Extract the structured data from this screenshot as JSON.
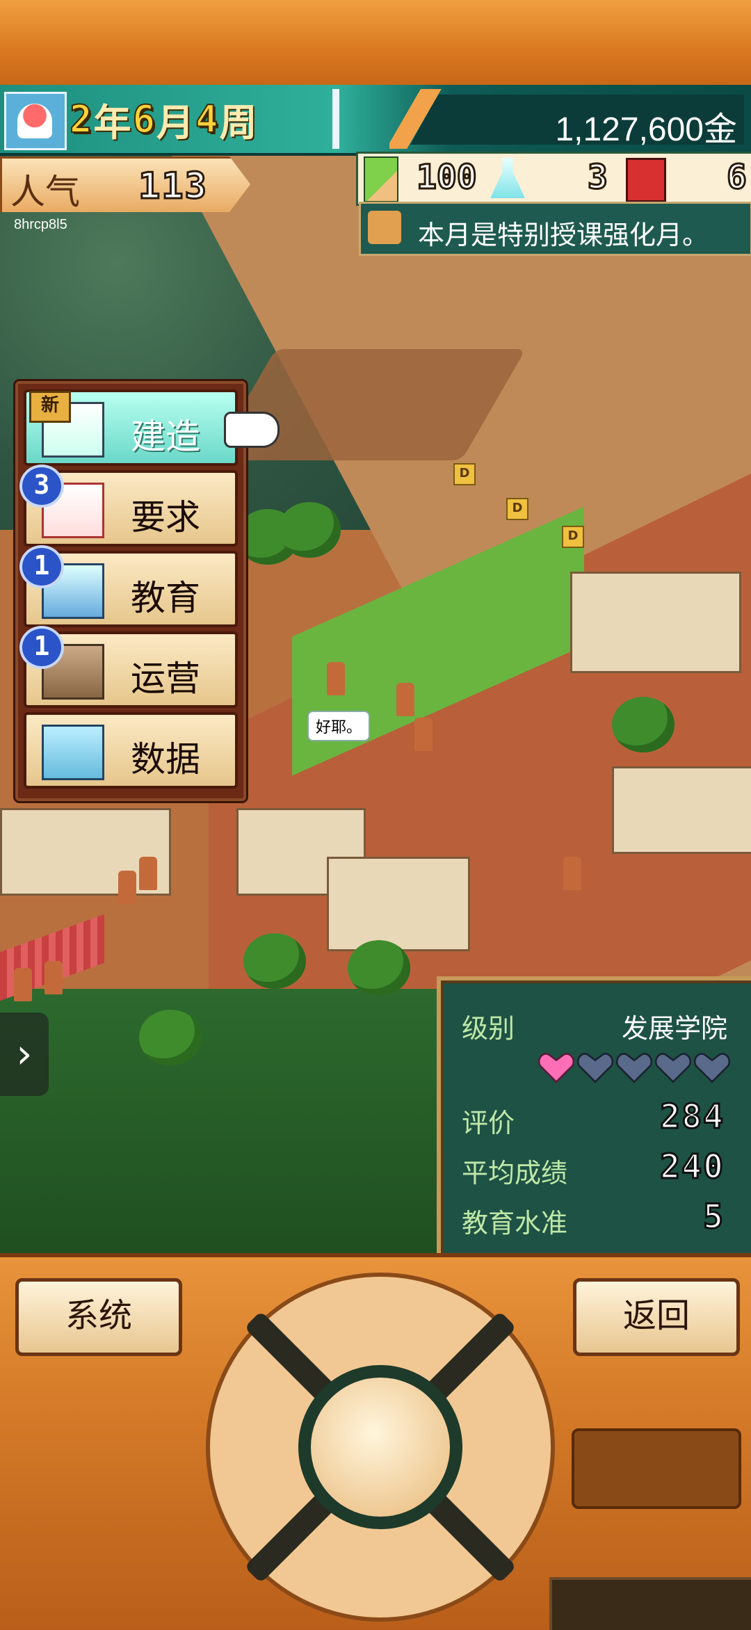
{
  "date": {
    "year": "2",
    "year_unit": "年",
    "month": "6",
    "month_unit": "月",
    "week": "4",
    "week_unit": "周"
  },
  "money": "1,127,600金",
  "popularity": {
    "label": "人气",
    "value": "113"
  },
  "user_tag": "8hrcp8l5",
  "resources": {
    "research": "100",
    "flask": "3",
    "bag": "6"
  },
  "notice": "本月是特别授课强化月。",
  "speech_bubble": "好耶。",
  "sign_letter": "D",
  "menu": {
    "items": [
      {
        "label": "建造",
        "badge": "新"
      },
      {
        "label": "要求",
        "badge": "3"
      },
      {
        "label": "教育",
        "badge": "1"
      },
      {
        "label": "运营",
        "badge": "1"
      },
      {
        "label": "数据",
        "badge": ""
      }
    ]
  },
  "status": {
    "rank_label": "级别",
    "rank_value": "发展学院",
    "hearts_filled": 1,
    "hearts_total": 5,
    "rating_label": "评价",
    "rating_value": "284",
    "avg_grade_label": "平均成绩",
    "avg_grade_value": "240",
    "edu_level_label": "教育水准",
    "edu_level_value": "5"
  },
  "controls": {
    "system": "系统",
    "back": "返回"
  },
  "side_arrow": "›",
  "colors": {
    "heart_filled": "#ff6fb8",
    "heart_empty": "#5a6a8a",
    "accent": "#1e8f7f"
  }
}
